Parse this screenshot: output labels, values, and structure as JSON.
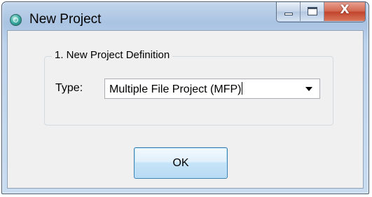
{
  "window": {
    "title": "New Project"
  },
  "caption_buttons": {
    "close_glyph": "X"
  },
  "group": {
    "title": "1. New Project Definition"
  },
  "type_field": {
    "label": "Type:",
    "value": "Multiple File Project (MFP)"
  },
  "buttons": {
    "ok_label": "OK"
  },
  "colors": {
    "title_bar": "#a9c3e2",
    "close_button": "#c0432a",
    "dialog_body": "#f0f0f0"
  }
}
